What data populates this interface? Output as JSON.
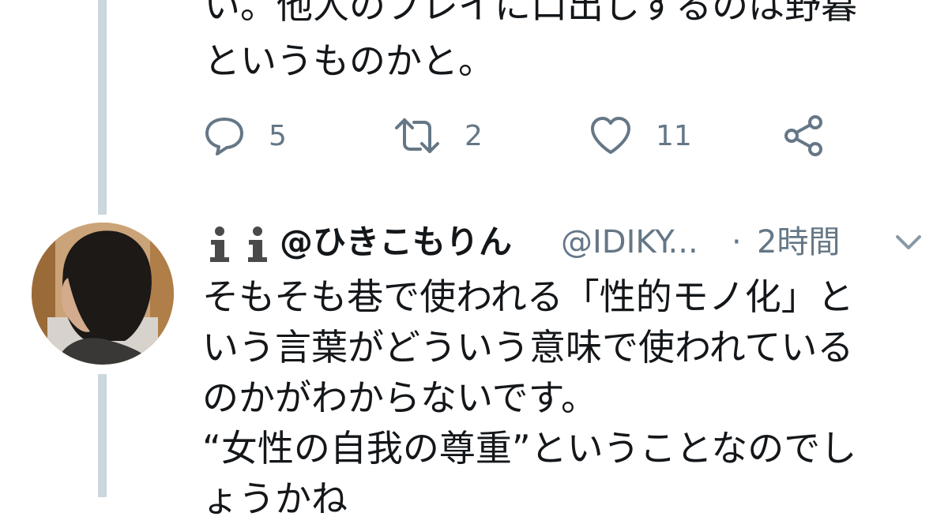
{
  "previous_tweet": {
    "text_lines": [
      "い。他人のプレイに口出しするのは野暮",
      "というものかと。"
    ],
    "actions": {
      "reply_count": "5",
      "retweet_count": "2",
      "like_count": "11"
    }
  },
  "tweet": {
    "display_name": "@ひきこもりん",
    "handle": "@IDIKY...",
    "separator": "·",
    "time": "2時間",
    "text_lines": [
      "そもそも巷で使われる「性的モノ化」と",
      "いう言葉がどういう意味で使われている",
      "のかがわからないです。",
      "“女性の自我の尊重”ということなのでし",
      "ょうかね"
    ]
  },
  "icons": {
    "reply": "reply-icon",
    "retweet": "retweet-icon",
    "like": "heart-icon",
    "share": "share-icon",
    "badges": "info-icon",
    "menu": "chevron-down-icon"
  },
  "colors": {
    "text": "#14171a",
    "muted": "#657786",
    "thread_line": "#ccd6dd"
  }
}
